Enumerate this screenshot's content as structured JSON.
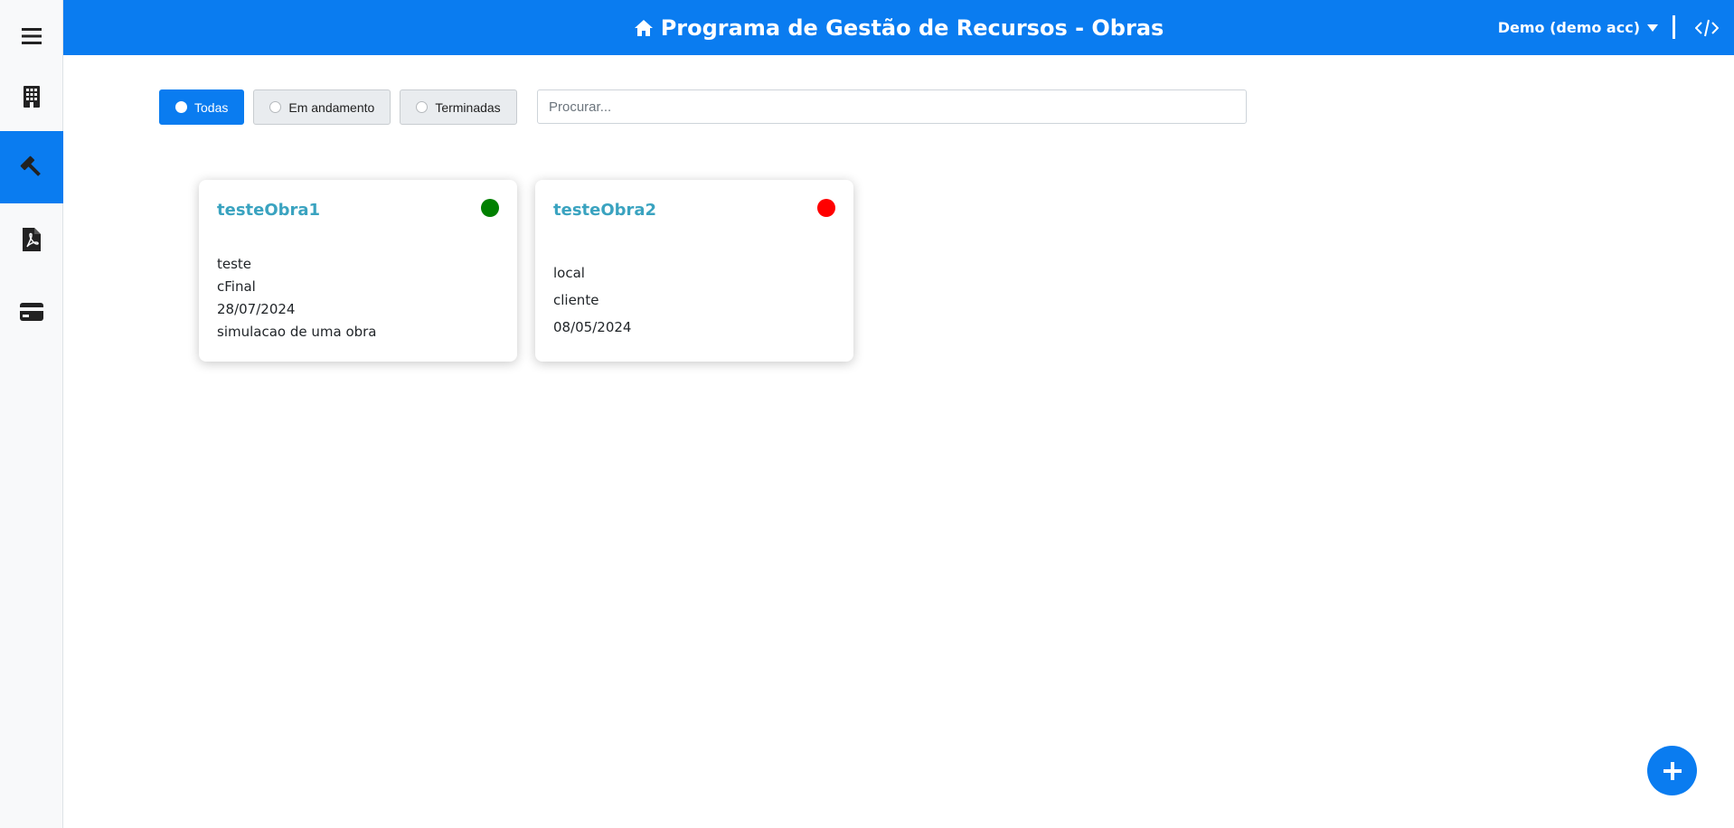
{
  "header": {
    "title": "Programa de Gestão de Recursos - Obras",
    "home_icon": "home-icon",
    "user_label": "Demo (demo acc)",
    "code_icon": "code-icon",
    "background": "#0a7cf0"
  },
  "sidebar": {
    "items": [
      {
        "name": "menu",
        "icon": "hamburger-icon"
      },
      {
        "name": "buildings",
        "icon": "building-icon"
      },
      {
        "name": "works",
        "icon": "hammer-icon",
        "active": true
      },
      {
        "name": "pdf",
        "icon": "pdf-icon"
      },
      {
        "name": "payments",
        "icon": "credit-card-icon"
      }
    ]
  },
  "filters": {
    "options": [
      {
        "label": "Todas",
        "selected": true
      },
      {
        "label": "Em andamento",
        "selected": false
      },
      {
        "label": "Terminadas",
        "selected": false
      }
    ],
    "search_placeholder": "Procurar..."
  },
  "cards": [
    {
      "title": "testeObra1",
      "status_color": "#008000",
      "lines": [
        "teste",
        "cFinal",
        "28/07/2024",
        "simulacao de uma obra"
      ]
    },
    {
      "title": "testeObra2",
      "status_color": "#ff0000",
      "lines": [
        "local",
        "cliente",
        "08/05/2024"
      ]
    }
  ],
  "fab": {
    "icon": "plus-icon"
  }
}
